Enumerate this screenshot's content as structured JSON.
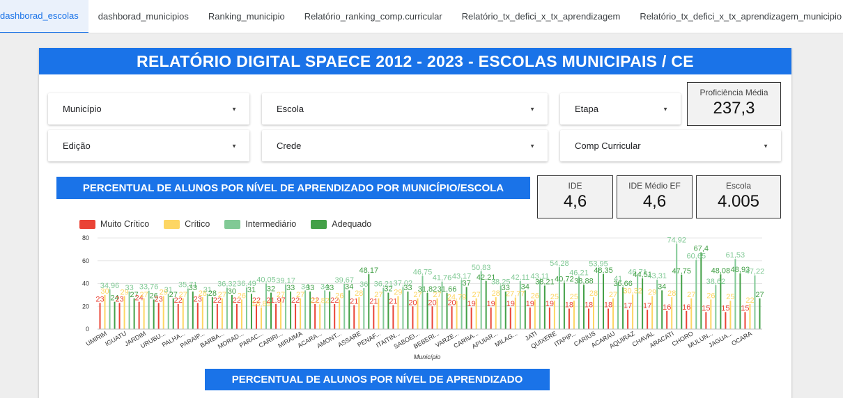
{
  "tabs": [
    {
      "label": "dashborad_escolas",
      "active": true
    },
    {
      "label": "dashborad_municipios",
      "active": false
    },
    {
      "label": "Ranking_municipio",
      "active": false
    },
    {
      "label": "Relatório_ranking_comp.curricular",
      "active": false
    },
    {
      "label": "Relatório_tx_defici_x_tx_aprendizagem",
      "active": false
    },
    {
      "label": "Relatório_tx_defici_x_tx_aprendizagem_municipio",
      "active": false
    }
  ],
  "report": {
    "title": "RELATÓRIO DIGITAL SPAECE 2012 - 2023 - ESCOLAS MUNICIPAIS / CE",
    "filters": {
      "municipio": "Município",
      "escola": "Escola",
      "etapa": "Etapa",
      "edicao": "Edição",
      "crede": "Crede",
      "comp_curricular": "Comp Curricular"
    },
    "dropdown_caret": "▼",
    "scorecards": {
      "proficiencia": {
        "label": "Proficiência Média",
        "value": "237,3"
      },
      "ide": {
        "label": "IDE",
        "value": "4,6"
      },
      "ide_medio": {
        "label": "IDE Médio EF",
        "value": "4,6"
      },
      "escola": {
        "label": "Escola",
        "value": "4.005"
      }
    },
    "chart_banner": "PERCENTUAL DE ALUNOS POR NÍVEL DE APRENDIZADO POR MUNICÍPIO/ESCOLA",
    "bottom_banner": "PERCENTUAL DE ALUNOS POR NÍVEL DE APRENDIZADO"
  },
  "colors": {
    "primary": "#1a73e8",
    "muito_critico": "#ea4335",
    "critico": "#fdd663",
    "intermediario": "#81c995",
    "adequado": "#43a047"
  },
  "chart_data": {
    "type": "bar",
    "xlabel": "Município",
    "ylabel": "",
    "ylim": [
      0,
      80
    ],
    "yticks": [
      0,
      20,
      40,
      60,
      80
    ],
    "grid": true,
    "legend_position": "top-left",
    "series": [
      {
        "name": "Muito Crítico",
        "color": "#ea4335"
      },
      {
        "name": "Crítico",
        "color": "#fdd663"
      },
      {
        "name": "Intermediário",
        "color": "#81c995"
      },
      {
        "name": "Adequado",
        "color": "#43a047"
      }
    ],
    "categories": [
      {
        "name": "UMIRIM",
        "values": [
          23,
          30,
          34.96,
          24
        ]
      },
      {
        "name": "IGUATU",
        "values": [
          23,
          29,
          33,
          27
        ]
      },
      {
        "name": "JARDIM",
        "values": [
          24,
          27,
          33.76,
          26
        ]
      },
      {
        "name": "URUBU...",
        "values": [
          23,
          29,
          31,
          27
        ]
      },
      {
        "name": "PALHA...",
        "values": [
          22,
          27,
          35.71,
          33
        ]
      },
      {
        "name": "PARAIP...",
        "values": [
          23,
          28,
          31,
          28
        ]
      },
      {
        "name": "BARBA...",
        "values": [
          22,
          27,
          36.32,
          30
        ]
      },
      {
        "name": "MORAD...",
        "values": [
          22,
          26,
          36.49,
          31
        ]
      },
      {
        "name": "PARAC...",
        "values": [
          22,
          18.89,
          40.05,
          32
        ]
      },
      {
        "name": "CARIRI...",
        "values": [
          21.97,
          27,
          39.17,
          33
        ]
      },
      {
        "name": "MIRAIMA",
        "values": [
          22,
          27,
          34,
          33
        ]
      },
      {
        "name": "ACARA...",
        "values": [
          22,
          21.82,
          34,
          33
        ]
      },
      {
        "name": "AMONT...",
        "values": [
          22,
          26,
          39.67,
          34
        ]
      },
      {
        "name": "ASSARE",
        "values": [
          21,
          28,
          36,
          48.17
        ]
      },
      {
        "name": "PENAF...",
        "values": [
          21,
          27,
          36.21,
          32
        ]
      },
      {
        "name": "ITAITIN...",
        "values": [
          21,
          29,
          37.02,
          33
        ]
      },
      {
        "name": "SABOEI...",
        "values": [
          20,
          27,
          46.75,
          31.82
        ]
      },
      {
        "name": "BEBERI...",
        "values": [
          20,
          27,
          41.76,
          31.66
        ]
      },
      {
        "name": "VARZE...",
        "values": [
          20,
          24.79,
          43.17,
          37
        ]
      },
      {
        "name": "CARNA...",
        "values": [
          19,
          27,
          50.83,
          42.21
        ]
      },
      {
        "name": "APUIAR...",
        "values": [
          19,
          28,
          38.25,
          33
        ]
      },
      {
        "name": "MILAG...",
        "values": [
          19,
          27.77,
          42.11,
          34
        ]
      },
      {
        "name": "JATI",
        "values": [
          19,
          26,
          43.11,
          38.21
        ]
      },
      {
        "name": "QUIXERE",
        "values": [
          19,
          25,
          54.28,
          40.72
        ]
      },
      {
        "name": "ITAPIP...",
        "values": [
          18,
          25,
          46.21,
          38.88
        ]
      },
      {
        "name": "CARIUS",
        "values": [
          18,
          28,
          53.95,
          48.35
        ]
      },
      {
        "name": "ACARAU",
        "values": [
          18,
          27,
          41,
          36.66
        ]
      },
      {
        "name": "AQUIRAZ",
        "values": [
          17,
          30.32,
          46.71,
          44.51
        ]
      },
      {
        "name": "CHAVAL",
        "values": [
          17,
          29,
          43.31,
          34
        ]
      },
      {
        "name": "ARACATI",
        "values": [
          16,
          28,
          74.92,
          47.75
        ]
      },
      {
        "name": "CHORO",
        "values": [
          16,
          27,
          60.65,
          67.4
        ]
      },
      {
        "name": "MULUN...",
        "values": [
          15,
          26,
          38.62,
          48.08
        ]
      },
      {
        "name": "JAGUA...",
        "values": [
          15,
          25,
          61.53,
          48.93
        ]
      },
      {
        "name": "OCARA",
        "values": [
          15,
          22,
          47.22,
          27
        ]
      }
    ]
  }
}
